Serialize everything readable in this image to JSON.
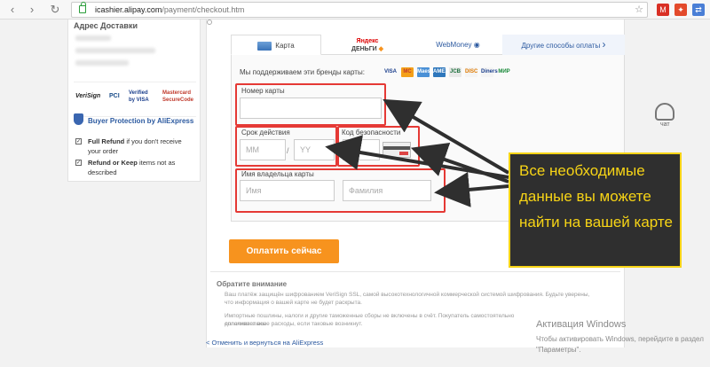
{
  "browser": {
    "url_domain": "icashier.alipay.com",
    "url_path": "/payment/checkout.htm",
    "back_icon": "chevron-left-icon",
    "forward_icon": "chevron-right-icon",
    "reload_icon": "reload-icon"
  },
  "left_panel": {
    "address_title": "Адрес Доставки",
    "trust_badges": [
      "VeriSign",
      "PCI",
      "Verified by VISA",
      "Mastercard SecureCode"
    ],
    "buyer_protection_title": "Buyer Protection by AliExpress",
    "full_refund_bold": "Full Refund",
    "full_refund_text": "if you don't receive your order",
    "refund_keep_bold": "Refund or Keep",
    "refund_keep_text": "items not as described"
  },
  "tabs": {
    "card": "Карта",
    "yandex_line1": "Яндекс",
    "yandex_line2": "ДЕНЬГИ",
    "webmoney": "WebMoney",
    "other": "Другие способы оплаты"
  },
  "form": {
    "brands_text": "Мы поддерживаем эти бренды карты:",
    "brands": [
      "VISA",
      "MC",
      "Maestro",
      "AMEX",
      "JCB",
      "DISC",
      "Diners",
      "МИР"
    ],
    "card_number_label": "Номер карты",
    "expiry_label": "Срок действия",
    "mm_placeholder": "MM",
    "slash": "/",
    "yy_placeholder": "YY",
    "cvv_label": "Код безопасности",
    "holder_label": "Имя владельца карты",
    "first_name_placeholder": "Имя",
    "last_name_placeholder": "Фамилия"
  },
  "pay_button": "Оплатить сейчас",
  "notes": {
    "title": "Обратите внимание",
    "line1": "Ваш платёж защищён шифрованием VeriSign SSL, самой высокотехнологичной коммерческой системой шифрования. Будьте уверены,",
    "line2": "что информация о вашей карте не будет раскрыта.",
    "line3": "Импортные пошлины, налоги и другие таможенные сборы не включены в счёт. Покупатель самостоятельно оплачивает все",
    "line4": "дополнительные расходы, если таковые возникнут."
  },
  "back_link": "< Отменить и вернуться на AliExpress",
  "chat_label": "чат",
  "callout_text": "Все необходимые данные вы можете найти на вашей карте",
  "windows": {
    "title": "Активация Windows",
    "subtitle": "Чтобы активировать Windows, перейдите в раздел \"Параметры\"."
  },
  "colors": {
    "accent_orange": "#f7931e",
    "highlight_red": "#e53935",
    "callout_yellow": "#f7d416",
    "link_blue": "#2c5aa0"
  }
}
